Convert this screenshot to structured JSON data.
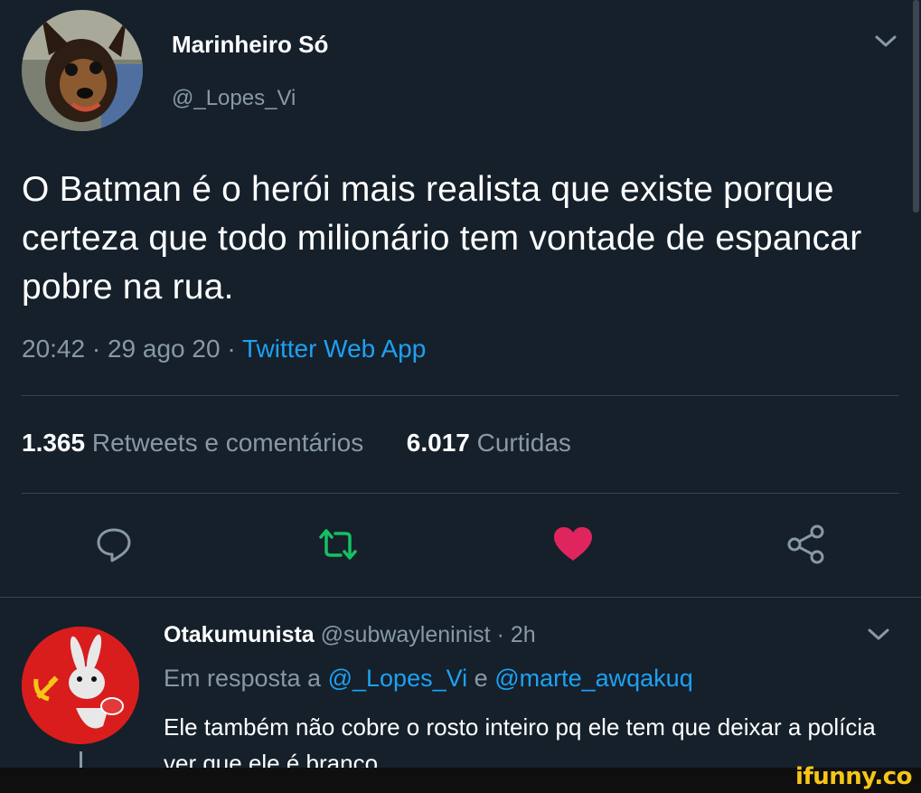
{
  "tweet": {
    "author_name": "Marinheiro Só",
    "author_handle": "@_Lopes_Vi",
    "text": "O Batman é o herói mais realista que existe porque certeza que todo milionário tem vontade de espancar pobre na rua.",
    "time": "20:42",
    "date": "29 ago 20",
    "source": "Twitter Web App",
    "retweets_count": "1.365",
    "retweets_label": "Retweets e comentários",
    "likes_count": "6.017",
    "likes_label": "Curtidas",
    "liked": true
  },
  "actions": [
    "reply-icon",
    "retweet-icon",
    "like-icon",
    "share-icon"
  ],
  "reply": {
    "author_name": "Otakumunista",
    "author_handle": "@subwayleninist",
    "time": "2h",
    "reply_prefix": "Em resposta a",
    "mention_1": "@_Lopes_Vi",
    "conjunction": "e",
    "mention_2": "@marte_awqakuq",
    "text": "Ele também não cobre o rosto inteiro pq ele tem que deixar a polícia ver que ele é branco"
  },
  "watermark": "ifunny.co",
  "colors": {
    "background": "#15202b",
    "muted": "#8899a6",
    "link": "#1da1f2",
    "retweet": "#17bf63",
    "like": "#e0245e",
    "divider": "#38444d",
    "reply_avatar": "#d91d1d",
    "watermark": "#f5c518"
  }
}
